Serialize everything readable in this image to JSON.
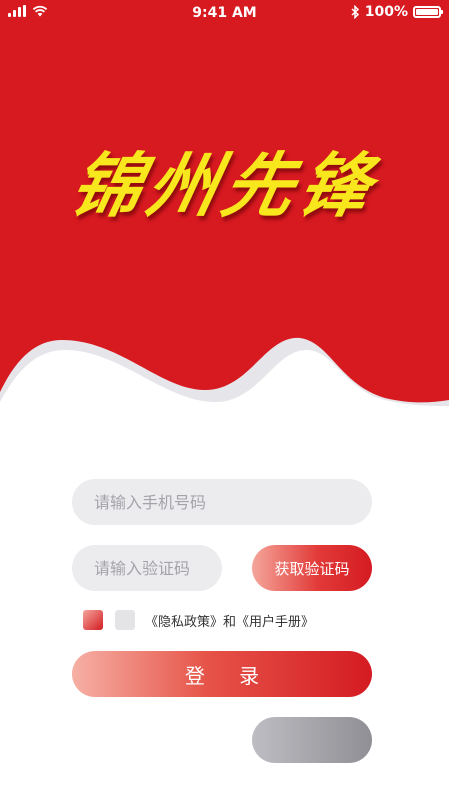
{
  "status_bar": {
    "time": "9:41 AM",
    "battery_text": "100%",
    "battery_level": 1.0,
    "icons": [
      "signal-icon",
      "wifi-icon",
      "bluetooth-icon",
      "battery-icon"
    ]
  },
  "header": {
    "title": "锦州先锋"
  },
  "form": {
    "phone_placeholder": "请输入手机号码",
    "code_placeholder": "请输入验证码",
    "get_code_label": "获取验证码",
    "agreement_text": "《隐私政策》和《用户手册》",
    "login_label": "登 录",
    "secondary_label": ""
  },
  "colors": {
    "brand_red": "#d71920",
    "title_yellow": "#f8e71c",
    "field_bg": "#ececef",
    "grey_button": "#9a9a9f"
  }
}
